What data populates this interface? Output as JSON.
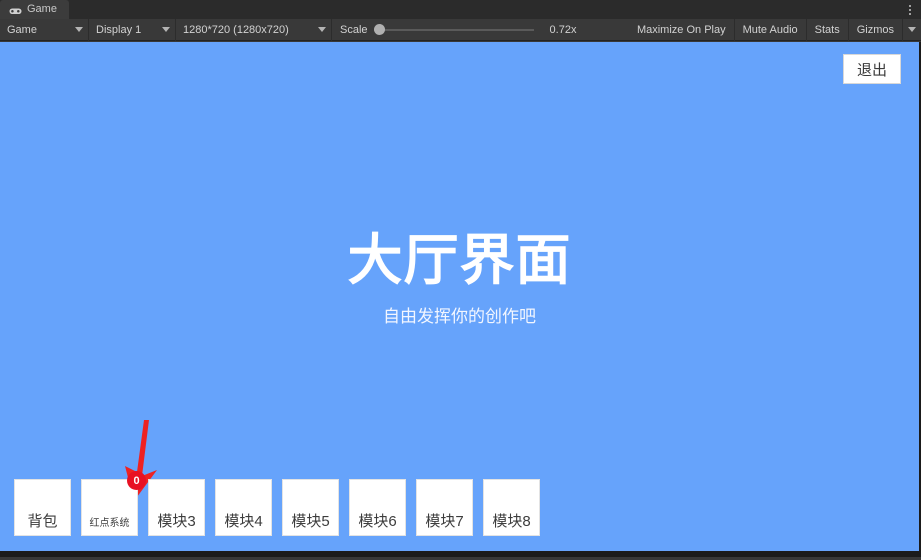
{
  "window": {
    "tab": {
      "label": "Game",
      "icon": "gamepad-icon"
    },
    "menu_icon": "kebab-menu-icon"
  },
  "toolbar": {
    "target_display_selector": {
      "value": "Game",
      "icon": "chevron-down-icon"
    },
    "display_selector": {
      "value": "Display 1",
      "icon": "chevron-down-icon"
    },
    "resolution_selector": {
      "value": "1280*720 (1280x720)",
      "icon": "chevron-down-icon"
    },
    "scale": {
      "label": "Scale",
      "value": "0.72x"
    },
    "maximize_on_play": "Maximize On Play",
    "mute_audio": "Mute Audio",
    "stats": "Stats",
    "gizmos": "Gizmos",
    "gizmos_caret_icon": "chevron-down-icon"
  },
  "game": {
    "background_color": "#66a3fb",
    "exit_button": "退出",
    "title": "大厅界面",
    "subtitle": "自由发挥你的创作吧",
    "annotation": {
      "icon": "down-arrow-icon",
      "color": "#ee2222"
    },
    "buttons": [
      {
        "label": "背包",
        "small": false,
        "badge": null
      },
      {
        "label": "红点系统",
        "small": true,
        "badge": "0"
      },
      {
        "label": "模块3",
        "small": false,
        "badge": null
      },
      {
        "label": "模块4",
        "small": false,
        "badge": null
      },
      {
        "label": "模块5",
        "small": false,
        "badge": null
      },
      {
        "label": "模块6",
        "small": false,
        "badge": null
      },
      {
        "label": "模块7",
        "small": false,
        "badge": null
      },
      {
        "label": "模块8",
        "small": false,
        "badge": null
      }
    ],
    "badge_color": "#e81123"
  }
}
